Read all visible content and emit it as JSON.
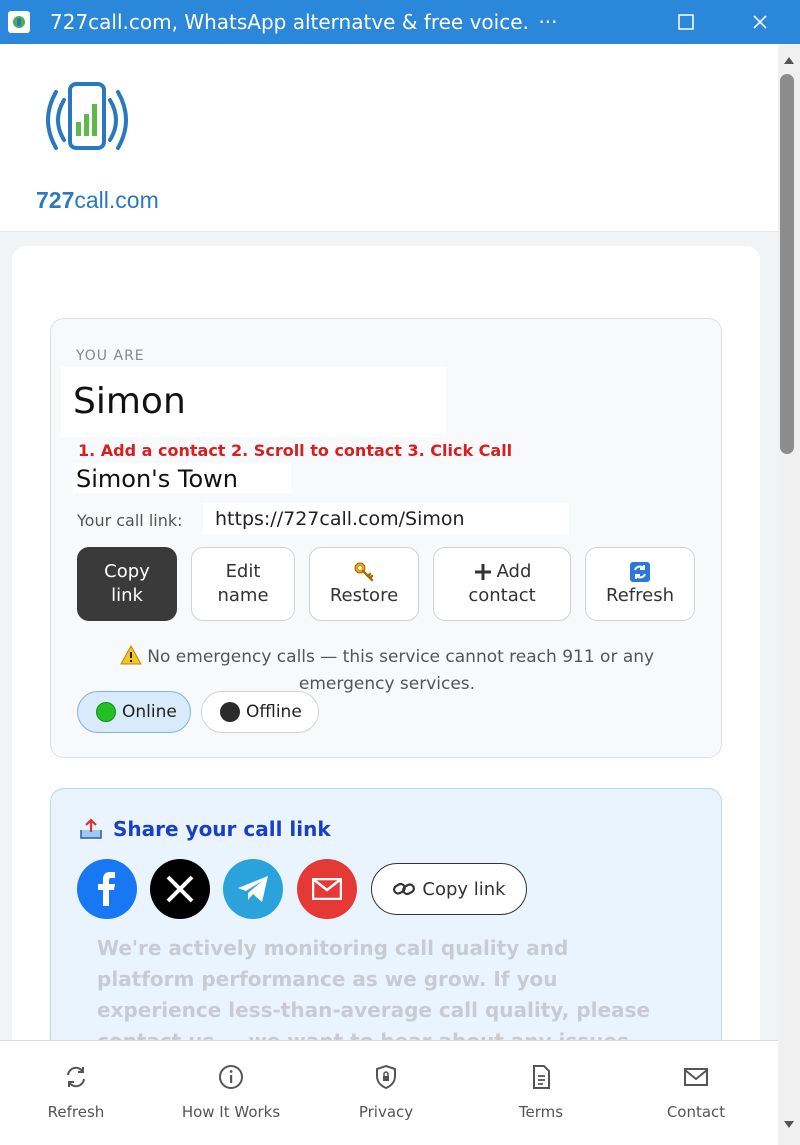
{
  "window": {
    "title": "727call.com, WhatsApp alternatve & free voice...",
    "more_label": "···",
    "minimize_label": "—",
    "maximize_label": "☐",
    "close_label": "✕"
  },
  "logo": {
    "brand": "727",
    "brand_rest": "call.com"
  },
  "profile": {
    "you_are": "YOU ARE",
    "name": "Simon",
    "steps": "1. Add a contact  2. Scroll to contact  3. Click Call",
    "town": "Simon's Town",
    "link_label": "Your call link:",
    "link_value": "https://727call.com/Simon",
    "buttons": {
      "copy_line1": "Copy",
      "copy_line2": "link",
      "edit_line1": "Edit",
      "edit_line2": "name",
      "restore": "Restore",
      "add_line1": "Add",
      "add_line2": "contact",
      "refresh": "Refresh"
    },
    "warning_line1": "No emergency calls — this service cannot reach 911 or any",
    "warning_line2": "emergency services.",
    "status_online": "Online",
    "status_offline": "Offline"
  },
  "share": {
    "title": "Share your call link",
    "copy_link": "Copy link",
    "monitor_text": "We're actively monitoring call quality and platform performance as we grow. If you experience less-than-average call quality, please contact us — we want to hear about any issues so we can fix them"
  },
  "nav": {
    "refresh": "Refresh",
    "how": "How It Works",
    "privacy": "Privacy",
    "terms": "Terms",
    "contact": "Contact"
  },
  "colors": {
    "titlebar": "#2b87d9",
    "online_dot": "#22c022",
    "offline_dot": "#2b2b2b",
    "facebook": "#1877f2",
    "x": "#000000",
    "telegram": "#2aa3dd",
    "email": "#e53935",
    "steps_red": "#d62020"
  }
}
